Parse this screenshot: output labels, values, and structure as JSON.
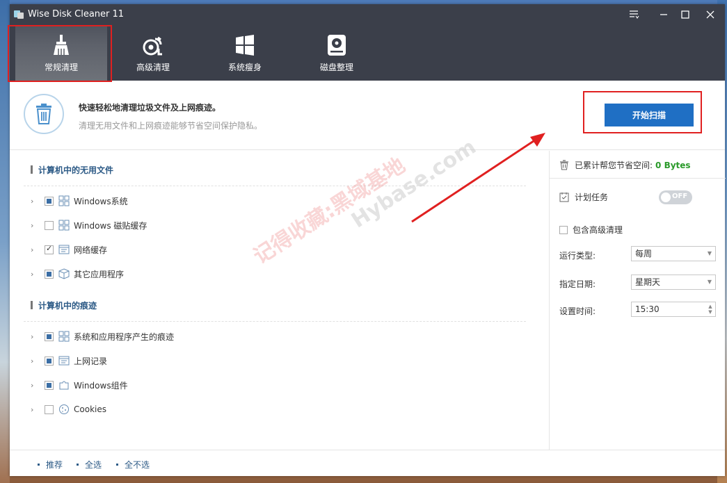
{
  "window": {
    "title": "Wise Disk Cleaner 11"
  },
  "tabs": [
    {
      "label": "常规清理",
      "icon": "broom-icon"
    },
    {
      "label": "高级清理",
      "icon": "advanced-clean-icon"
    },
    {
      "label": "系统瘦身",
      "icon": "windows-icon"
    },
    {
      "label": "磁盘整理",
      "icon": "disk-icon"
    }
  ],
  "header": {
    "title": "快速轻松地清理垃圾文件及上网痕迹。",
    "subtitle": "清理无用文件和上网痕迹能够节省空间保护隐私。",
    "scan_label": "开始扫描"
  },
  "sections": [
    {
      "title": "计算机中的无用文件",
      "items": [
        {
          "label": "Windows系统",
          "check": "partial",
          "icon": "windows-tile-icon"
        },
        {
          "label": "Windows 磁贴缓存",
          "check": "none",
          "icon": "windows-tile-icon"
        },
        {
          "label": "网络缓存",
          "check": "full",
          "icon": "browser-icon"
        },
        {
          "label": "其它应用程序",
          "check": "partial",
          "icon": "box-icon"
        }
      ]
    },
    {
      "title": "计算机中的痕迹",
      "items": [
        {
          "label": "系统和应用程序产生的痕迹",
          "check": "partial",
          "icon": "windows-tile-icon"
        },
        {
          "label": "上网记录",
          "check": "partial",
          "icon": "browser-icon"
        },
        {
          "label": "Windows组件",
          "check": "partial",
          "icon": "puzzle-icon"
        },
        {
          "label": "Cookies",
          "check": "none",
          "icon": "cookie-icon"
        }
      ]
    }
  ],
  "right": {
    "saved_label": "已累计帮您节省空间:",
    "saved_value": "0 Bytes",
    "schedule_label": "计划任务",
    "toggle_label": "OFF",
    "advanced_label": "包含高级清理",
    "run_type_label": "运行类型:",
    "run_type_value": "每周",
    "date_label": "指定日期:",
    "date_value": "星期天",
    "time_label": "设置时间:",
    "time_value": "15:30"
  },
  "footer": {
    "recommend": "推荐",
    "select_all": "全选",
    "select_none": "全不选"
  },
  "watermark": {
    "line1": "记得收藏:黑域基地",
    "line2": "Hybase.com"
  },
  "colors": {
    "titlebar": "#3b3f4a",
    "accent": "#1f6fc4",
    "highlight": "#e02020",
    "saved_value": "#2a9a2a"
  }
}
